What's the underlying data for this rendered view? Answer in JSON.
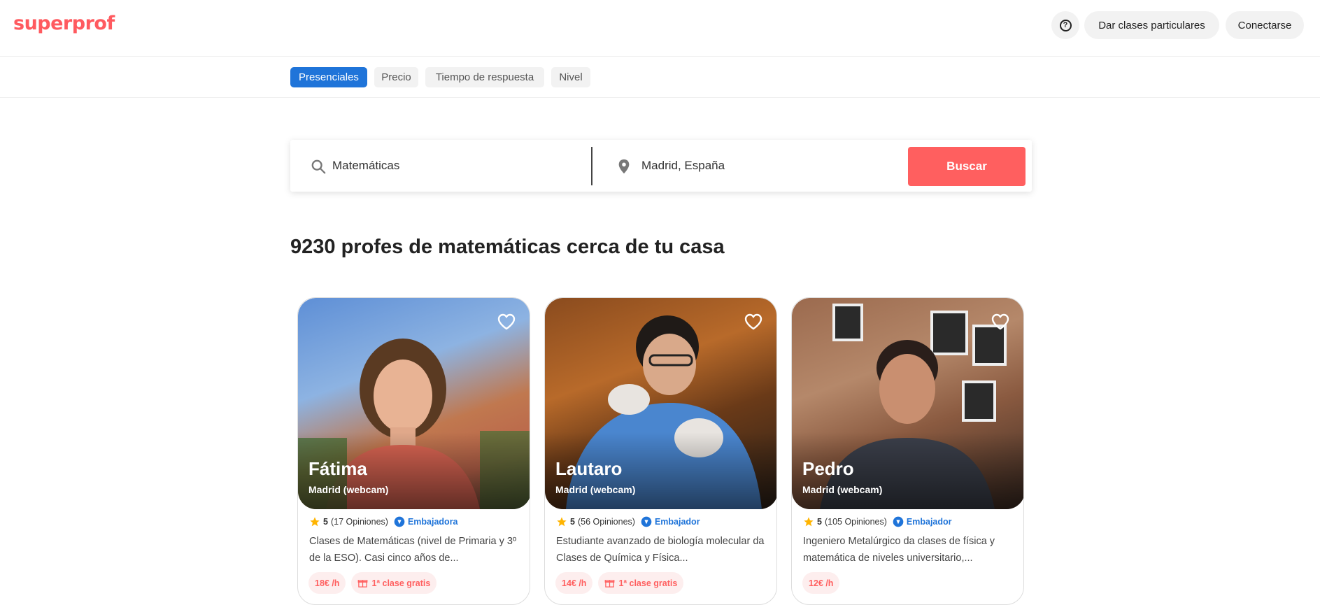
{
  "header": {
    "logo": "superprof",
    "help_icon": "help-icon",
    "teach_label": "Dar clases particulares",
    "login_label": "Conectarse"
  },
  "filters": [
    {
      "label": "Presenciales",
      "active": true
    },
    {
      "label": "Precio",
      "active": false
    },
    {
      "label": "Tiempo de respuesta",
      "active": false
    },
    {
      "label": "Nivel",
      "active": false
    }
  ],
  "search": {
    "subject": "Matemáticas",
    "location": "Madrid, España",
    "button": "Buscar",
    "icons": [
      "search-icon",
      "location-pin-icon"
    ]
  },
  "results_title": "9230 profes de matemáticas cerca de tu casa",
  "colors": {
    "brand": "#ff5a5f",
    "active_chip": "#1f74d9",
    "search_button": "#ff5f5f",
    "ambassador": "#1f74d9"
  },
  "tutors": [
    {
      "name": "Fátima",
      "location": "Madrid (webcam)",
      "rating": "5",
      "reviews": "(17 Opiniones)",
      "ambassador": "Embajadora",
      "description": "Clases de Matemáticas (nivel de Primaria y 3º de la ESO). Casi cinco años de...",
      "price": "18€ /h",
      "free_class": "1ª clase gratis"
    },
    {
      "name": "Lautaro",
      "location": "Madrid (webcam)",
      "rating": "5",
      "reviews": "(56 Opiniones)",
      "ambassador": "Embajador",
      "description": "Estudiante avanzado de biología molecular da Clases de Química y Física...",
      "price": "14€ /h",
      "free_class": "1ª clase gratis"
    },
    {
      "name": "Pedro",
      "location": "Madrid (webcam)",
      "rating": "5",
      "reviews": "(105 Opiniones)",
      "ambassador": "Embajador",
      "description": "Ingeniero Metalúrgico da clases de física y matemática de niveles universitario,...",
      "price": "12€ /h",
      "free_class": ""
    }
  ]
}
